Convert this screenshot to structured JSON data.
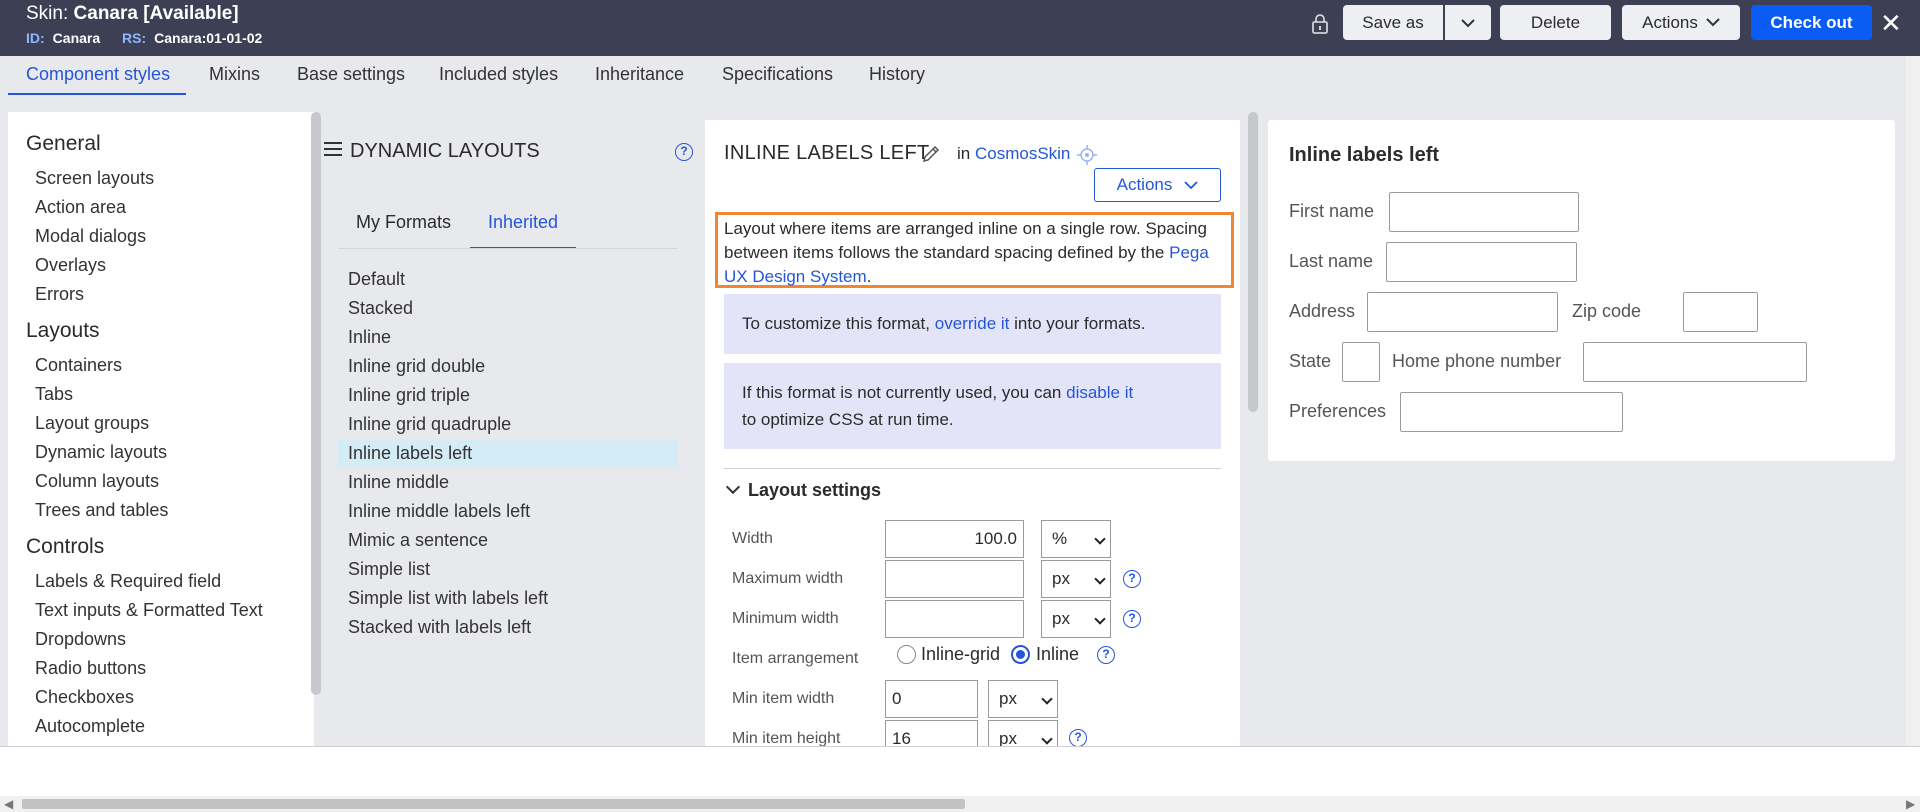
{
  "header": {
    "title_prefix": "Skin:",
    "title_value": "Canara [Available]",
    "id_label": "ID:",
    "id_value": "Canara",
    "rs_label": "RS:",
    "rs_value": "Canara:01-01-02",
    "save_as": "Save as",
    "delete": "Delete",
    "actions": "Actions",
    "check_out": "Check out",
    "close": "✕"
  },
  "tabs": [
    "Component styles",
    "Mixins",
    "Base settings",
    "Included styles",
    "Inheritance",
    "Specifications",
    "History"
  ],
  "nav": {
    "general_heading": "General",
    "general_items": [
      "Screen layouts",
      "Action area",
      "Modal dialogs",
      "Overlays",
      "Errors"
    ],
    "layouts_heading": "Layouts",
    "layouts_items": [
      "Containers",
      "Tabs",
      "Layout groups",
      "Dynamic layouts",
      "Column layouts",
      "Trees and tables"
    ],
    "controls_heading": "Controls",
    "controls_items": [
      "Labels & Required field",
      "Text inputs & Formatted Text",
      "Dropdowns",
      "Radio buttons",
      "Checkboxes",
      "Autocomplete"
    ]
  },
  "dynamic": {
    "title": "DYNAMIC LAYOUTS",
    "help": "?",
    "tab_my": "My Formats",
    "tab_inherited": "Inherited",
    "formats": [
      "Default",
      "Stacked",
      "Inline",
      "Inline grid double",
      "Inline grid triple",
      "Inline grid quadruple",
      "Inline labels left",
      "Inline middle",
      "Inline middle labels left",
      "Mimic a sentence",
      "Simple list",
      "Simple list with labels left",
      "Stacked with labels left"
    ],
    "selected": "Inline labels left"
  },
  "detail": {
    "title": "INLINE LABELS LEFT",
    "in_label": "in",
    "skin_link": "CosmosSkin",
    "actions": "Actions",
    "desc_text": "Layout where items are arranged inline on a single row. Spacing between items follows the standard spacing defined by the",
    "desc_link": "Pega UX Design System",
    "desc_end": ".",
    "customize_pre": "To customize this format,",
    "customize_link": "override it",
    "customize_post": "into your formats.",
    "disable_pre": "If this format is not currently used, you can",
    "disable_link": "disable it",
    "disable_post": "to optimize CSS at run time.",
    "section": "Layout settings",
    "width_label": "Width",
    "width_value": "100.0",
    "width_unit": "%",
    "max_width_label": "Maximum width",
    "max_width_value": "",
    "max_width_unit": "px",
    "min_width_label": "Minimum width",
    "min_width_value": "",
    "min_width_unit": "px",
    "arrangement_label": "Item arrangement",
    "arr_opt1": "Inline-grid",
    "arr_opt2": "Inline",
    "arr_selected": "Inline",
    "min_item_width_label": "Min item width",
    "min_item_width_value": "0",
    "min_item_width_unit": "px",
    "min_item_height_label": "Min item height",
    "min_item_height_value": "16",
    "min_item_height_unit": "px"
  },
  "preview": {
    "title": "Inline labels left",
    "first_name": "First name",
    "last_name": "Last name",
    "address": "Address",
    "zip": "Zip code",
    "state": "State",
    "home_phone": "Home phone number",
    "preferences": "Preferences"
  },
  "colors": {
    "header_bg": "#3d4054",
    "accent": "#2556d9",
    "primary_button": "#0b5cf5",
    "highlight_border": "#f08532",
    "selected_row": "#d4ecf6",
    "info_bg": "#e4e4f9"
  },
  "icons": [
    "lock-icon",
    "chevron-down-icon",
    "close-icon",
    "hamburger-icon",
    "help-icon",
    "pencil-icon",
    "target-icon"
  ]
}
